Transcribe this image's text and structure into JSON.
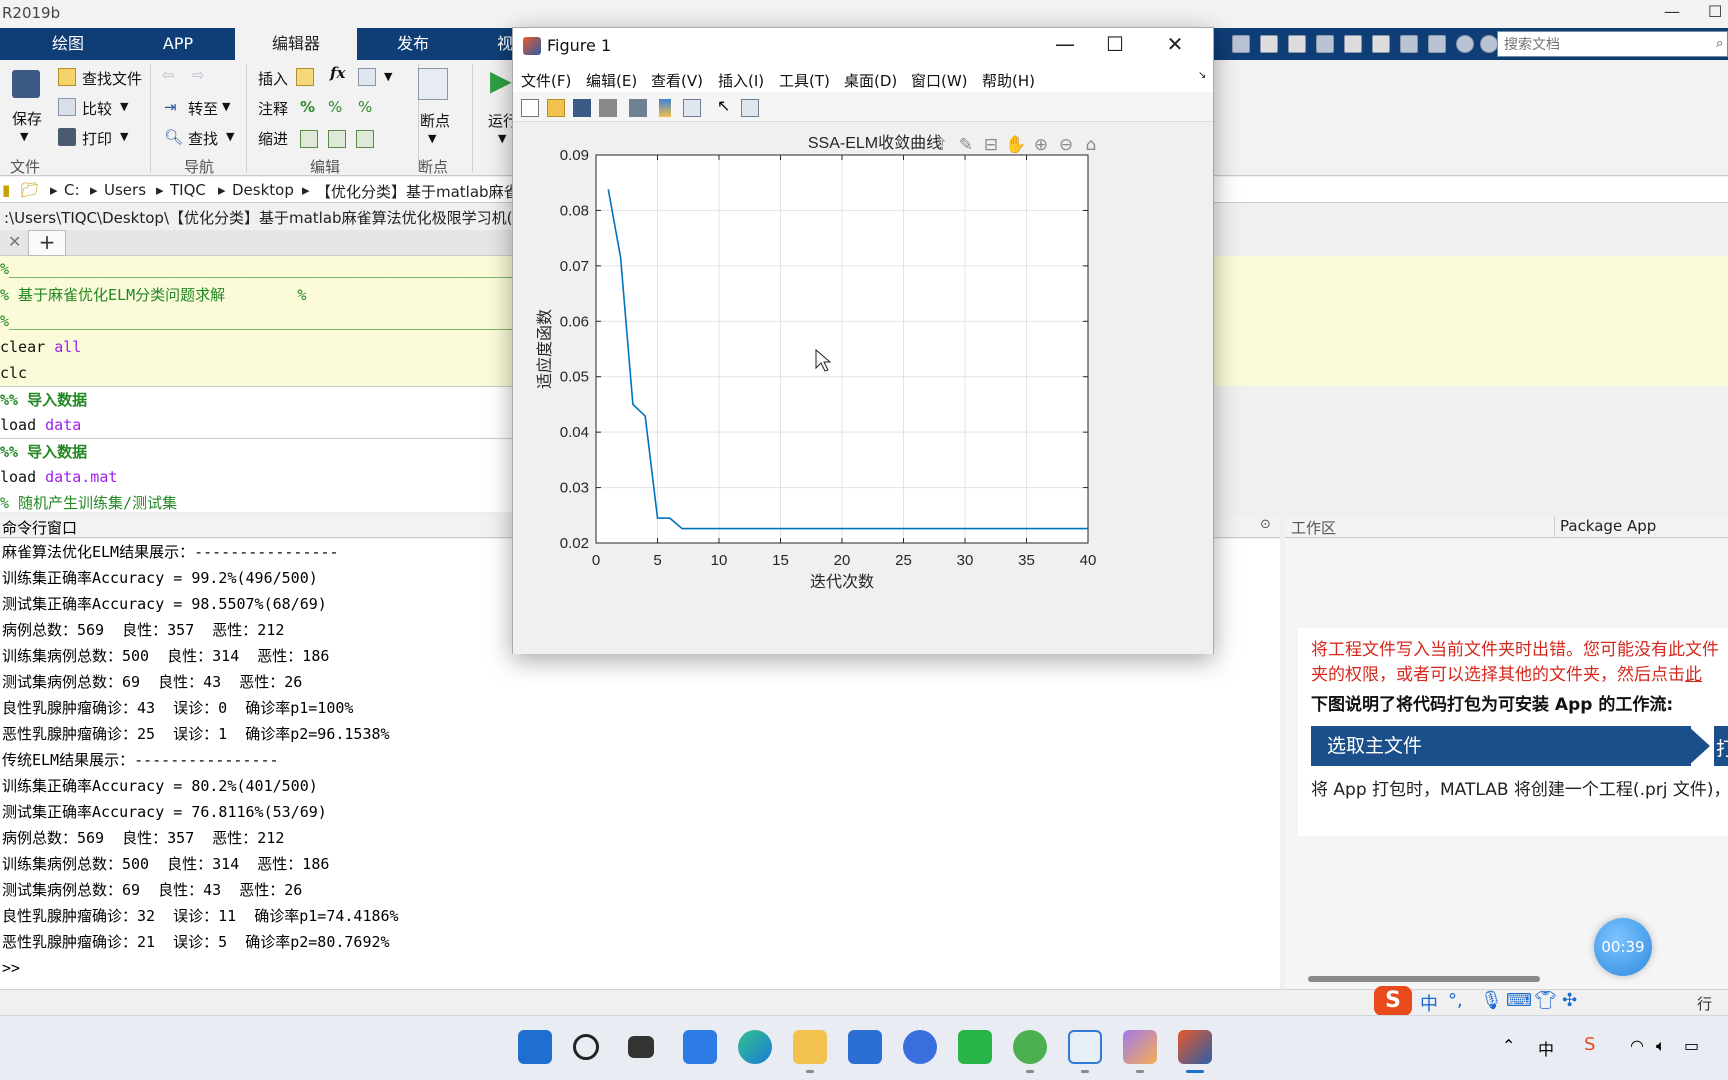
{
  "app": {
    "title": "R2019b"
  },
  "ribbon": {
    "tabs": [
      {
        "label": "绘图"
      },
      {
        "label": "APP"
      },
      {
        "label": "编辑器"
      },
      {
        "label": "发布"
      },
      {
        "label": "视"
      }
    ],
    "file_group": {
      "save": "保存",
      "find_files": "查找文件",
      "compare": "比较",
      "print": "打印",
      "label": "文件"
    },
    "nav_group": {
      "goto": "转至",
      "find": "查找",
      "label": "导航"
    },
    "edit_group": {
      "insert": "插入",
      "comment": "注释",
      "indent": "缩进",
      "fx": "fx",
      "label": "编辑"
    },
    "breakpoint_group": {
      "breakpoints": "断点",
      "label": "断点"
    },
    "run_group": {
      "run": "运行"
    },
    "search_placeholder": "搜索文档"
  },
  "address": {
    "crumbs": [
      "C:",
      "Users",
      "TIQC",
      "Desktop",
      "【优化分类】基于matlab麻雀"
    ],
    "full_path": ":\\Users\\TIQC\\Desktop\\【优化分类】基于matlab麻雀算法优化极限学习机(E"
  },
  "editor": {
    "lines": [
      {
        "text": "%_______________________________________________________________________",
        "style": "cm",
        "cell": true
      },
      {
        "text": "% 基于麻雀优化ELM分类问题求解        %",
        "style": "cm",
        "cell": true
      },
      {
        "text": "%_______________________________________________________________________",
        "style": "cm",
        "cell": true
      },
      {
        "text": "clear all",
        "style": "kw",
        "cell": true
      },
      {
        "text": "clc",
        "style": "kw",
        "cell": true
      },
      {
        "text": "%% 导入数据",
        "style": "cmb",
        "cell": false
      },
      {
        "text": "load data",
        "style": "kw",
        "cell": false
      },
      {
        "text": "%% 导入数据",
        "style": "cmb",
        "cell": false
      },
      {
        "text": "load data.mat",
        "style": "kw",
        "cell": false
      },
      {
        "text": "% 随机产生训练集/测试集",
        "style": "cm",
        "cell": false
      }
    ]
  },
  "command_window": {
    "title": "命令行窗口",
    "lines": [
      "麻雀算法优化ELM结果展示：----------------",
      "训练集正确率Accuracy = 99.2%(496/500)",
      "测试集正确率Accuracy = 98.5507%(68/69)",
      "病例总数：569  良性：357  恶性：212",
      "训练集病例总数：500  良性：314  恶性：186",
      "测试集病例总数：69  良性：43  恶性：26",
      "良性乳腺肿瘤确诊：43  误诊：0  确诊率p1=100%",
      "恶性乳腺肿瘤确诊：25  误诊：1  确诊率p2=96.1538%",
      "传统ELM结果展示：----------------",
      "训练集正确率Accuracy = 80.2%(401/500)",
      "测试集正确率Accuracy = 76.8116%(53/69)",
      "病例总数：569  良性：357  恶性：212",
      "训练集病例总数：500  良性：314  恶性：186",
      "测试集病例总数：69  良性：43  恶性：26",
      "良性乳腺肿瘤确诊：32  误诊：11  确诊率p1=74.4186%",
      "恶性乳腺肿瘤确诊：21  误诊：5  确诊率p2=80.7692%"
    ],
    "prompt": ">>"
  },
  "workspace": {
    "tab_workspace": "工作区",
    "tab_package": "Package App",
    "error_text": "将工程文件写入当前文件夹时出错。您可能没有此文件夹的权限，或者可以选择其他的文件夹，然后点击此处。",
    "error_link": "此处",
    "heading": "下图说明了将代码打包为可安装 App 的工作流:",
    "step1": "选取主文件",
    "step2": "打",
    "desc": "将 App 打包时，MATLAB 将创建一个工程(.prj 文件)，以便您可以重新打包此工程而无需重新输入描述性信息。",
    "timer": "00:39"
  },
  "status_bar": {
    "right_label": "行"
  },
  "ime": {
    "zh": "中",
    "punct": "°,"
  },
  "figure": {
    "title": "Figure 1",
    "menus": [
      "文件(F)",
      "编辑(E)",
      "查看(V)",
      "插入(I)",
      "工具(T)",
      "桌面(D)",
      "窗口(W)",
      "帮助(H)"
    ]
  },
  "chart_data": {
    "type": "line",
    "title": "SSA-ELM收敛曲线",
    "xlabel": "迭代次数",
    "ylabel": "适应度函数",
    "xlim": [
      0,
      40
    ],
    "ylim": [
      0.02,
      0.09
    ],
    "xticks": [
      0,
      5,
      10,
      15,
      20,
      25,
      30,
      35,
      40
    ],
    "yticks": [
      0.02,
      0.03,
      0.04,
      0.05,
      0.06,
      0.07,
      0.08,
      0.09
    ],
    "ytick_labels": [
      "0.02",
      "0.03",
      "0.04",
      "0.05",
      "0.06",
      "0.07",
      "0.08",
      "0.09"
    ],
    "grid": true,
    "series": [
      {
        "color": "#0072bd",
        "x": [
          1,
          2,
          3,
          4,
          5,
          6,
          7,
          8,
          9,
          10,
          15,
          20,
          25,
          30,
          35,
          40
        ],
        "y": [
          0.0838,
          0.0715,
          0.045,
          0.0429,
          0.0245,
          0.0245,
          0.0226,
          0.0226,
          0.0226,
          0.0226,
          0.0226,
          0.0226,
          0.0226,
          0.0226,
          0.0226,
          0.0226
        ]
      }
    ]
  }
}
